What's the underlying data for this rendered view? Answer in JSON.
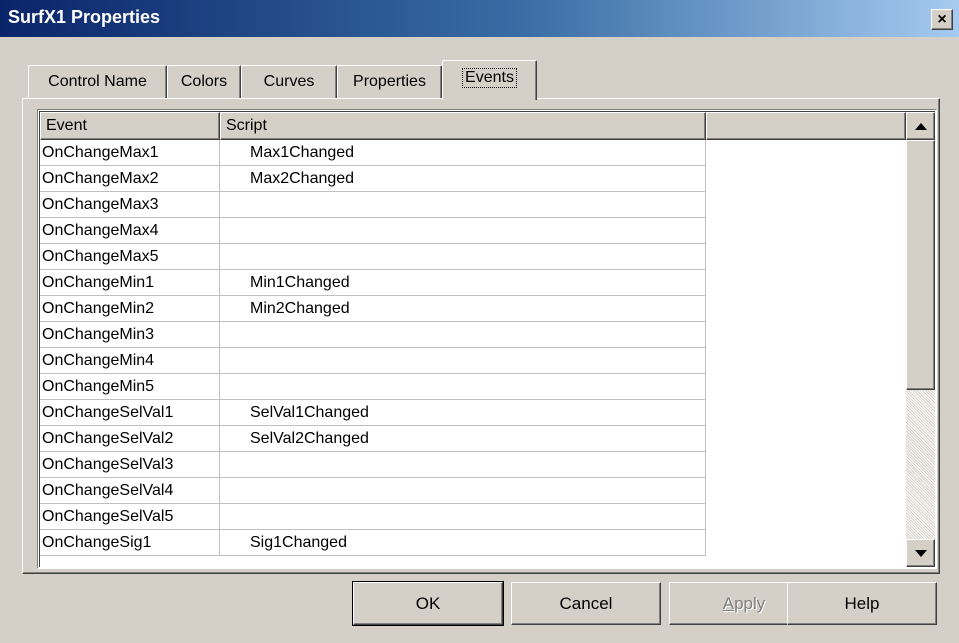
{
  "window": {
    "title": "SurfX1 Properties",
    "close_glyph": "×"
  },
  "tabs": [
    {
      "label": "Control Name",
      "active": false
    },
    {
      "label": "Colors",
      "active": false
    },
    {
      "label": "Curves",
      "active": false
    },
    {
      "label": "Properties",
      "active": false
    },
    {
      "label": "Events",
      "active": true
    }
  ],
  "events_list": {
    "columns": [
      "Event",
      "Script",
      ""
    ],
    "rows": [
      {
        "event": "OnChangeMax1",
        "script": "Max1Changed"
      },
      {
        "event": "OnChangeMax2",
        "script": "Max2Changed"
      },
      {
        "event": "OnChangeMax3",
        "script": ""
      },
      {
        "event": "OnChangeMax4",
        "script": ""
      },
      {
        "event": "OnChangeMax5",
        "script": ""
      },
      {
        "event": "OnChangeMin1",
        "script": "Min1Changed"
      },
      {
        "event": "OnChangeMin2",
        "script": "Min2Changed"
      },
      {
        "event": "OnChangeMin3",
        "script": ""
      },
      {
        "event": "OnChangeMin4",
        "script": ""
      },
      {
        "event": "OnChangeMin5",
        "script": ""
      },
      {
        "event": "OnChangeSelVal1",
        "script": "SelVal1Changed"
      },
      {
        "event": "OnChangeSelVal2",
        "script": "SelVal2Changed"
      },
      {
        "event": "OnChangeSelVal3",
        "script": ""
      },
      {
        "event": "OnChangeSelVal4",
        "script": ""
      },
      {
        "event": "OnChangeSelVal5",
        "script": ""
      },
      {
        "event": "OnChangeSig1",
        "script": "Sig1Changed"
      }
    ]
  },
  "buttons": {
    "ok": "OK",
    "cancel": "Cancel",
    "apply": "Apply",
    "help": "Help"
  },
  "colors": {
    "title_bar_start": "#0a246a",
    "title_bar_end": "#a6caf0",
    "face": "#d4d0c8"
  }
}
